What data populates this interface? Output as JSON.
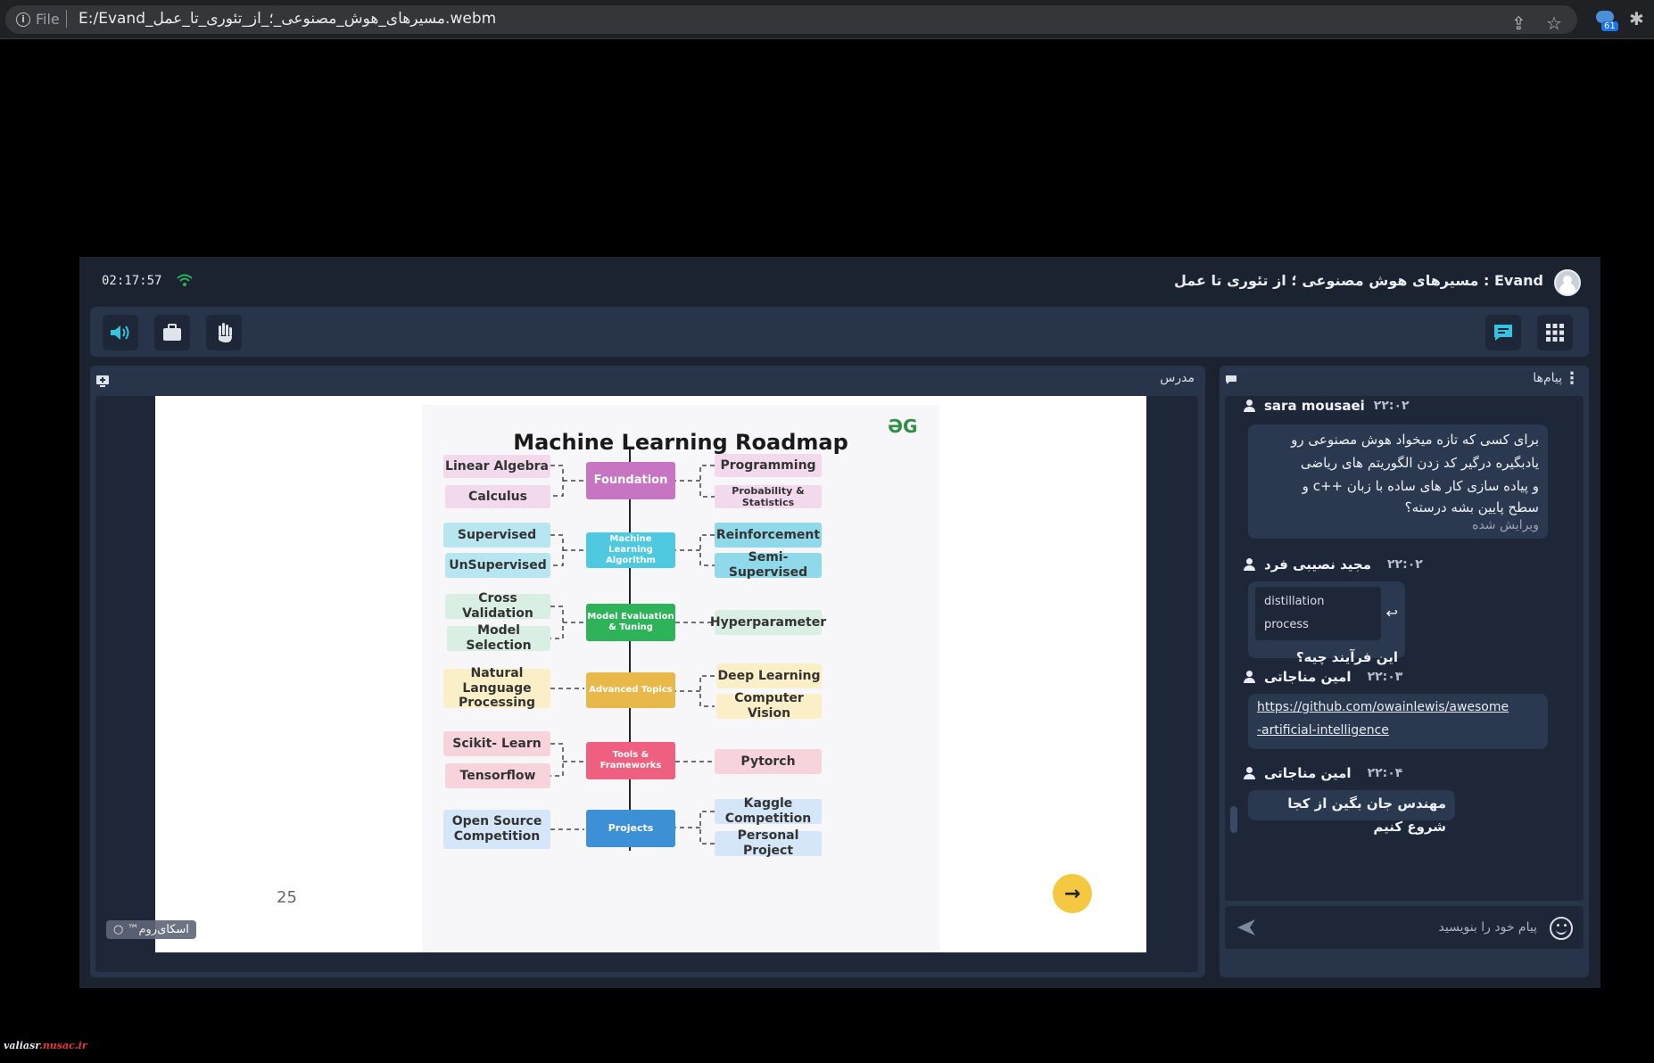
{
  "browser": {
    "scheme": "File",
    "url": "E:/Evand_مسیرهای_هوش_مصنوعی_؛_از_تئوری_تا_عمل.webm",
    "extension_badge": "61"
  },
  "app": {
    "clock": "02:17:57",
    "title": "Evand : مسیرهای هوش مصنوعی ؛ از تئوری تا عمل",
    "presenter_label": "مدرس",
    "brand": "اسکای‌روم™",
    "slide_page": "25"
  },
  "roadmap": {
    "title": "Machine Learning Roadmap",
    "logo": "ƏG",
    "left_nodes": [
      "Linear Algebra",
      "Calculus",
      "Supervised",
      "UnSupervised",
      "Cross Validation",
      "Model Selection",
      "Natural Language Processing",
      "Scikit- Learn",
      "Tensorflow",
      "Open Source Competition"
    ],
    "center_nodes": [
      "Foundation",
      "Machine Learning Algorithm",
      "Model Evaluation & Tuning",
      "Advanced Topics",
      "Tools & Frameworks",
      "Projects"
    ],
    "right_nodes": [
      "Programming",
      "Probability & Statistics",
      "Reinforcement",
      "Semi-Supervised",
      "Hyperparameter",
      "Deep Learning",
      "Computer Vision",
      "Pytorch",
      "Kaggle Competition",
      "Personal Project"
    ]
  },
  "chat": {
    "title": "پیام‌ها",
    "input_placeholder": "پیام خود را بنویسید",
    "messages": [
      {
        "user": "sara mousaei",
        "time": "۲۲:۰۲",
        "lines": [
          "برای کسی که تازه میخواد هوش مصنوعی رو",
          "یادبگیره درگیر کد زدن الگوریتم های ریاضی",
          "و پیاده سازی کار های ساده با زبان ++c و",
          "سطح پایین بشه درسته؟"
        ],
        "edited": "ویرایش شده"
      },
      {
        "user": "مجید نصیبی فرد",
        "time": "۲۲:۰۲",
        "reply_to": "distillation process",
        "text": "این فرآیند چیه؟"
      },
      {
        "user": "امین مناجاتی",
        "time": "۲۲:۰۳",
        "link_lines": [
          "https://github.com/owainlewis/awesome",
          "-artificial-intelligence"
        ]
      },
      {
        "user": "امین مناجاتی",
        "time": "۲۲:۰۴",
        "text": "مهندس جان بگین از کجا شروع کنیم"
      }
    ]
  },
  "watermark": {
    "part1": "valiasr",
    "part2": ".nusac.ir"
  },
  "colors": {
    "accent": "#35c3e0",
    "pink": "#c775c2",
    "cyan": "#4fc9e0",
    "green": "#2eb35a",
    "yellow": "#e8b84a",
    "red": "#ef5f7f",
    "blue": "#3d8fd6"
  }
}
